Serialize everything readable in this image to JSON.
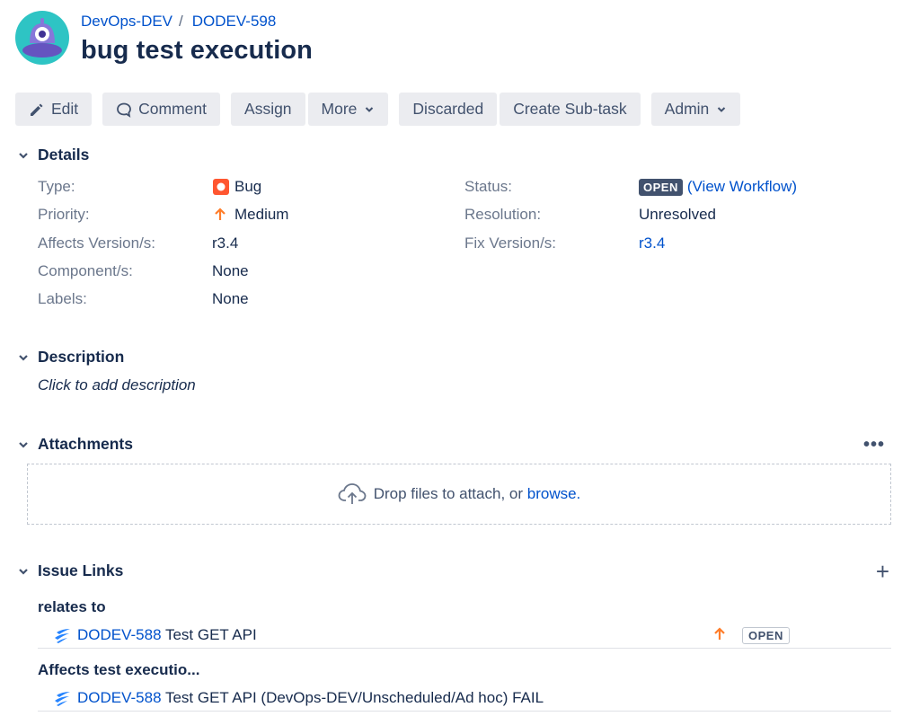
{
  "header": {
    "project_name": "DevOps-DEV",
    "separator": "/",
    "issue_key": "DODEV-598",
    "title": "bug test execution"
  },
  "toolbar": {
    "edit": "Edit",
    "comment": "Comment",
    "assign": "Assign",
    "more": "More",
    "discarded": "Discarded",
    "create_subtask": "Create Sub-task",
    "admin": "Admin"
  },
  "details": {
    "heading": "Details",
    "type_label": "Type:",
    "type_value": "Bug",
    "priority_label": "Priority:",
    "priority_value": "Medium",
    "affects_label": "Affects Version/s:",
    "affects_value": "r3.4",
    "component_label": "Component/s:",
    "component_value": "None",
    "labels_label": "Labels:",
    "labels_value": "None",
    "status_label": "Status:",
    "status_value": "OPEN",
    "view_workflow": "(View Workflow)",
    "resolution_label": "Resolution:",
    "resolution_value": "Unresolved",
    "fix_label": "Fix Version/s:",
    "fix_value": "r3.4"
  },
  "description": {
    "heading": "Description",
    "placeholder": "Click to add description"
  },
  "attachments": {
    "heading": "Attachments",
    "more": "•••",
    "drop_text": "Drop files to attach, or",
    "browse": "browse."
  },
  "issue_links": {
    "heading": "Issue Links",
    "add": "+",
    "groups": [
      {
        "type": "relates to",
        "key": "DODEV-588",
        "summary": "Test GET API",
        "status": "OPEN"
      },
      {
        "type": "Affects test executio...",
        "key": "DODEV-588",
        "summary": "Test GET API (DevOps-DEV/Unscheduled/Ad hoc) FAIL"
      }
    ]
  },
  "colors": {
    "link": "#0052cc",
    "bug": "#ff5630",
    "priority_medium": "#ff7d2a",
    "status_open_bg": "#42526e",
    "button_bg": "#ebecf0",
    "xray": "#2684ff"
  }
}
